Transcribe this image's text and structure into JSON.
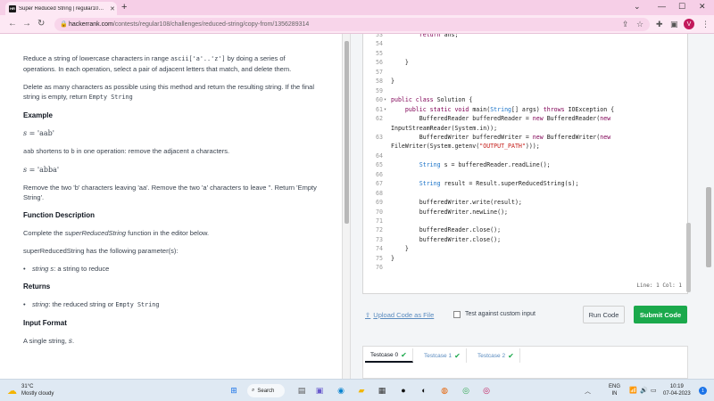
{
  "browser": {
    "tab_title": "Super Reduced String | regular10…",
    "tab_favicon": "HR",
    "new_tab": "+",
    "url_host": "hackerrank.com",
    "url_path": "/contests/regular108/challenges/reduced-string/copy-from/1356289314",
    "profile_initial": "V"
  },
  "problem": {
    "intro_a": "Reduce a string of lowercase characters in range ",
    "intro_code": "ascii['a'..'z']",
    "intro_b": " by doing a series of operations. In each operation, select a pair of adjacent letters that match, and delete them.",
    "para2_a": "Delete as many characters as possible using this method and return the resulting string. If the final string is empty, return ",
    "para2_code": "Empty String",
    "example_heading": "Example",
    "ex1_var": "s",
    "ex1_eq": " = 'aab'",
    "ex1_desc_code1": "aab",
    "ex1_desc_a": " shortens to ",
    "ex1_desc_code2": "b",
    "ex1_desc_b": " in one operation: remove the adjacent ",
    "ex1_desc_code3": "a",
    "ex1_desc_c": " characters.",
    "ex2_var": "s",
    "ex2_eq": " = 'abba'",
    "ex2_desc": "Remove the two 'b' characters leaving 'aa'. Remove the two 'a' characters to leave ''. Return 'Empty String'.",
    "func_heading": "Function Description",
    "func_desc_a": "Complete the ",
    "func_desc_em": "superReducedString",
    "func_desc_b": " function in the editor below.",
    "params_intro": "superReducedString has the following parameter(s):",
    "param1_em": "string s",
    "param1_rest": ": a string to reduce",
    "returns_heading": "Returns",
    "ret1_em": "string",
    "ret1_rest": ": the reduced string or ",
    "ret1_code": "Empty String",
    "input_heading": "Input Format",
    "input_desc_a": "A single string, ",
    "input_desc_var": "s",
    "input_desc_b": "."
  },
  "editor": {
    "lines": [
      {
        "n": "53",
        "fold": "",
        "html": "        <span class=\"kw\">return</span> ans;"
      },
      {
        "n": "54",
        "fold": "",
        "html": ""
      },
      {
        "n": "55",
        "fold": "",
        "html": ""
      },
      {
        "n": "56",
        "fold": "",
        "html": "    }"
      },
      {
        "n": "57",
        "fold": "",
        "html": ""
      },
      {
        "n": "58",
        "fold": "",
        "html": "}"
      },
      {
        "n": "59",
        "fold": "",
        "html": ""
      },
      {
        "n": "60",
        "fold": "▾",
        "html": "<span class=\"kw\">public class</span> Solution {"
      },
      {
        "n": "61",
        "fold": "▾",
        "html": "    <span class=\"kw\">public static void</span> main(<span class=\"ty\">String</span>[] args) <span class=\"kw\">throws</span> IOException {"
      },
      {
        "n": "62",
        "fold": "",
        "html": "        BufferedReader bufferedReader = <span class=\"kw\">new</span> BufferedReader(<span class=\"kw\">new</span>"
      },
      {
        "n": "",
        "fold": "",
        "html": "InputStreamReader(System.in));"
      },
      {
        "n": "63",
        "fold": "",
        "html": "        BufferedWriter bufferedWriter = <span class=\"kw\">new</span> BufferedWriter(<span class=\"kw\">new</span>"
      },
      {
        "n": "",
        "fold": "",
        "html": "FileWriter(System.getenv(<span class=\"st\">\"OUTPUT_PATH\"</span>)));"
      },
      {
        "n": "64",
        "fold": "",
        "html": ""
      },
      {
        "n": "65",
        "fold": "",
        "html": "        <span class=\"ty\">String</span> s = bufferedReader.readLine();"
      },
      {
        "n": "66",
        "fold": "",
        "html": ""
      },
      {
        "n": "67",
        "fold": "",
        "html": "        <span class=\"ty\">String</span> result = Result.superReducedString(s);"
      },
      {
        "n": "68",
        "fold": "",
        "html": ""
      },
      {
        "n": "69",
        "fold": "",
        "html": "        bufferedWriter.write(result);"
      },
      {
        "n": "70",
        "fold": "",
        "html": "        bufferedWriter.newLine();"
      },
      {
        "n": "71",
        "fold": "",
        "html": ""
      },
      {
        "n": "72",
        "fold": "",
        "html": "        bufferedReader.close();"
      },
      {
        "n": "73",
        "fold": "",
        "html": "        bufferedWriter.close();"
      },
      {
        "n": "74",
        "fold": "",
        "html": "    }"
      },
      {
        "n": "75",
        "fold": "",
        "html": "}"
      },
      {
        "n": "76",
        "fold": "",
        "html": ""
      }
    ],
    "status": "Line: 1 Col: 1"
  },
  "actions": {
    "upload_label": "Upload Code as File",
    "custom_input_label": "Test against custom input",
    "run_label": "Run Code",
    "submit_label": "Submit Code"
  },
  "testcases": {
    "tabs": [
      "Testcase 0",
      "Testcase 1",
      "Testcase 2"
    ]
  },
  "taskbar": {
    "temp": "31°C",
    "condition": "Mostly cloudy",
    "search_label": "Search",
    "lang1": "ENG",
    "lang2": "IN",
    "time": "10:19",
    "date": "07-04-2023",
    "notif_count": "1"
  }
}
